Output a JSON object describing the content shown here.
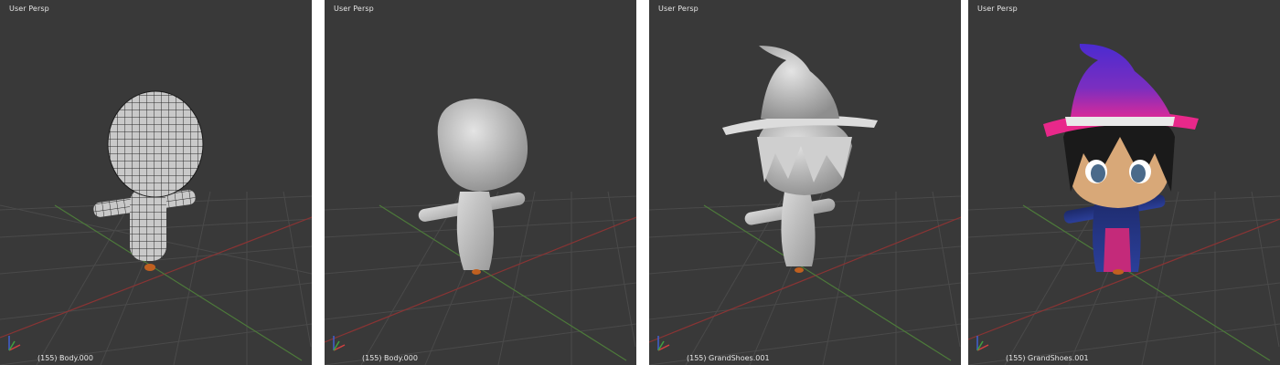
{
  "viewports": [
    {
      "view_label": "User Persp",
      "status": "(155) Body.000",
      "shading": "wireframe-mesh"
    },
    {
      "view_label": "User Persp",
      "status": "(155) Body.000",
      "shading": "solid"
    },
    {
      "view_label": "User Persp",
      "status": "(155) GrandShoes.001",
      "shading": "solid"
    },
    {
      "view_label": "User Persp",
      "status": "(155) GrandShoes.001",
      "shading": "textured"
    }
  ],
  "colors": {
    "viewport_bg": "#393939",
    "grid_line": "#4a4a4a",
    "x_axis": "#8a3434",
    "y_axis": "#4d7a3a",
    "hat_purple": "#5a2bb8",
    "hat_brim": "#e8288a"
  },
  "icons": [
    "axis-gizmo-icon"
  ]
}
